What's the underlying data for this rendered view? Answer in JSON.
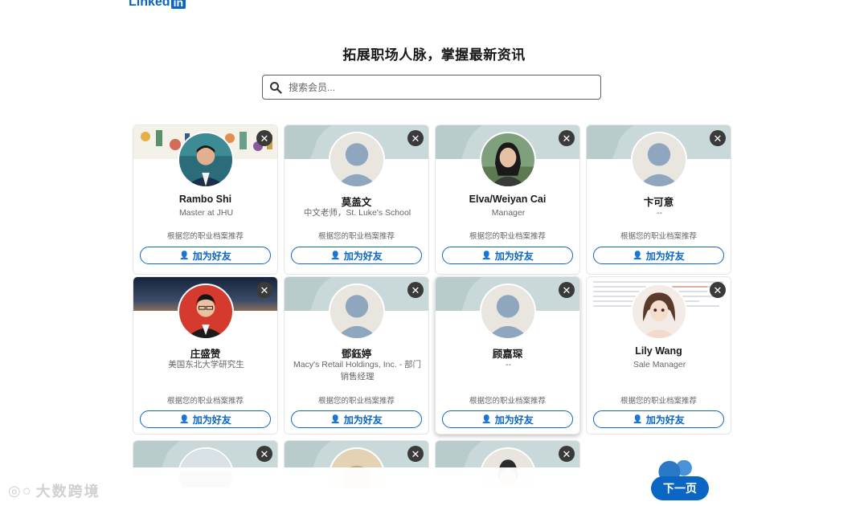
{
  "brand": {
    "logo_text": "Linked",
    "logo_in": "in",
    "color": "#0a66c2"
  },
  "heading": "拓展职场人脉，掌握最新资讯",
  "search": {
    "placeholder": "搜索会员..."
  },
  "common": {
    "reason": "根据您的职业档案推荐",
    "add_label": "加为好友",
    "close_glyph": "✕"
  },
  "cards": [
    {
      "name": "Rambo Shi",
      "headline": "Master at JHU",
      "photo": true
    },
    {
      "name": "莫盖文",
      "headline": "中文老师，St. Luke's School",
      "photo": false
    },
    {
      "name": "Elva/Weiyan Cai",
      "headline": "Manager",
      "photo": true
    },
    {
      "name": "卞可意",
      "headline": "--",
      "photo": false
    },
    {
      "name": "庄盛赞",
      "headline": "美国东北大学研究生",
      "photo": true
    },
    {
      "name": "鄧鈺婷",
      "headline": "Macy's Retail Holdings, Inc. - 部门销售经理",
      "photo": false
    },
    {
      "name": "顾嘉琛",
      "headline": "--",
      "photo": false
    },
    {
      "name": "Lily Wang",
      "headline": "Sale Manager",
      "photo": true
    }
  ],
  "footer": {
    "watermark": "大数跨境",
    "next_label": "下一页"
  }
}
